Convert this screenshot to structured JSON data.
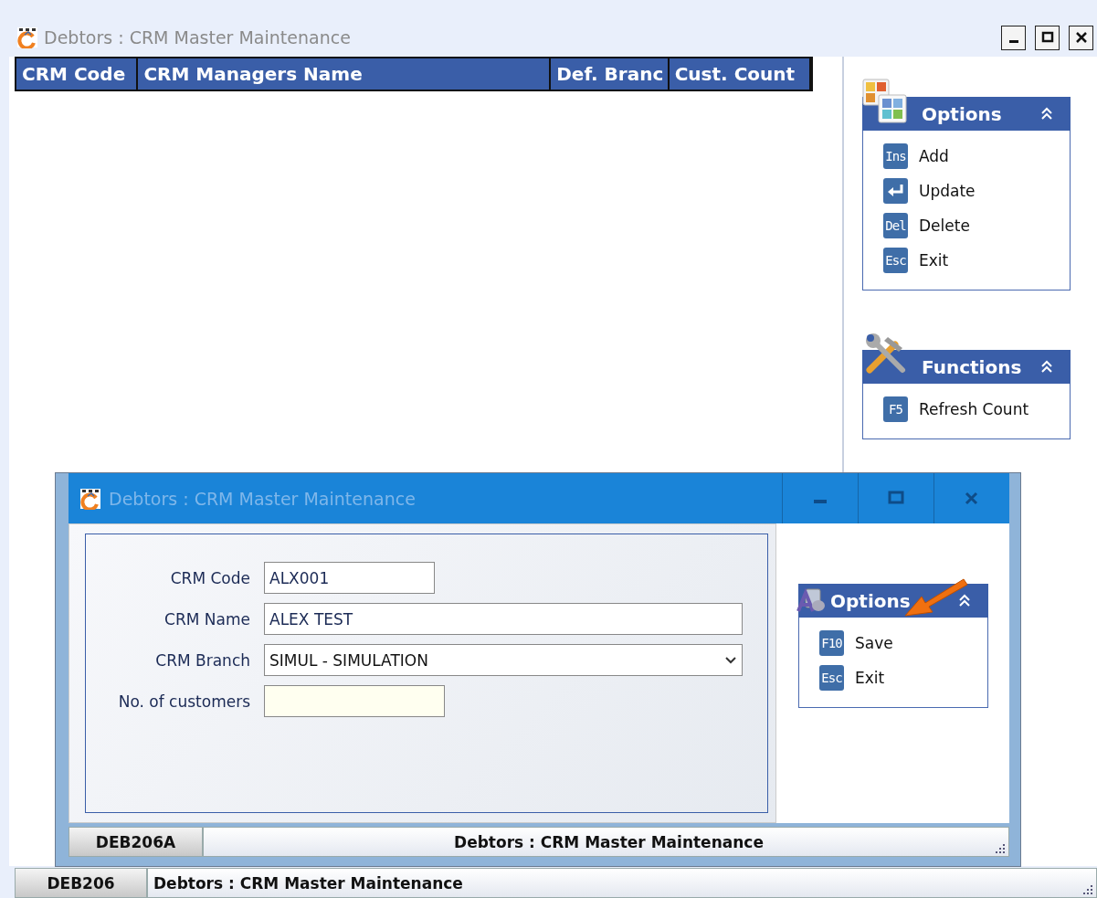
{
  "window": {
    "title": "Debtors : CRM Master Maintenance"
  },
  "table": {
    "columns": [
      "CRM Code",
      "CRM Managers Name",
      "Def. Branc",
      "Cust. Count"
    ]
  },
  "options_panel": {
    "title": "Options",
    "items": [
      {
        "kind": "key",
        "key": "Ins",
        "label": "Add"
      },
      {
        "kind": "enter",
        "label": "Update"
      },
      {
        "kind": "key",
        "key": "Del",
        "label": "Delete"
      },
      {
        "kind": "key",
        "key": "Esc",
        "label": "Exit"
      }
    ]
  },
  "functions_panel": {
    "title": "Functions",
    "items": [
      {
        "kind": "key",
        "key": "F5",
        "label": "Refresh Count"
      }
    ]
  },
  "status_bar": {
    "code": "DEB206",
    "text": "Debtors : CRM Master Maintenance"
  },
  "dialog": {
    "title": "Debtors : CRM Master Maintenance",
    "fields": [
      {
        "kind": "text",
        "label": "CRM Code",
        "value": "ALX001"
      },
      {
        "kind": "text",
        "label": "CRM Name",
        "value": "ALEX TEST"
      },
      {
        "kind": "select",
        "label": "CRM Branch",
        "value": "SIMUL - SIMULATION"
      },
      {
        "kind": "readonly",
        "label": "No. of customers"
      }
    ],
    "options_panel": {
      "title": "Options",
      "items": [
        {
          "kind": "key",
          "key": "F10",
          "label": "Save"
        },
        {
          "kind": "key",
          "key": "Esc",
          "label": "Exit"
        }
      ]
    },
    "status_bar": {
      "code": "DEB206A",
      "text": "Debtors : CRM Master Maintenance"
    }
  }
}
